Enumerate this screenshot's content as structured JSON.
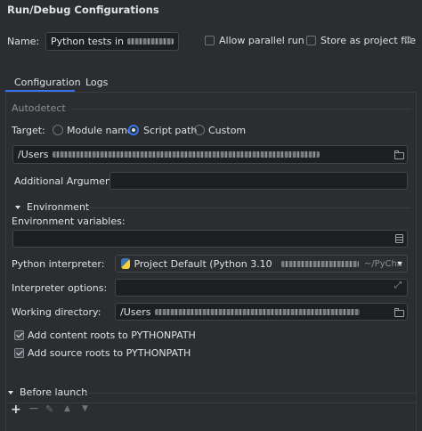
{
  "window": {
    "title": "Run/Debug Configurations"
  },
  "name_row": {
    "label": "Name:",
    "value": "Python tests in",
    "allow_parallel": "Allow parallel run",
    "store_project": "Store as project file"
  },
  "tabs": [
    {
      "label": "Configuration",
      "active": true
    },
    {
      "label": "Logs",
      "active": false
    }
  ],
  "autodetect": {
    "header": "Autodetect"
  },
  "target": {
    "label": "Target:",
    "options": [
      "Module name",
      "Script path",
      "Custom"
    ],
    "selected": "Script path"
  },
  "script_path": {
    "value": "/Users"
  },
  "additional_args": {
    "label": "Additional Arguments",
    "value": ""
  },
  "environment": {
    "header": "Environment",
    "env_vars_label": "Environment variables:",
    "env_vars_value": "",
    "interpreter_label": "Python interpreter:",
    "interpreter_value": "Project Default (Python 3.10",
    "interpreter_suffix": "~/PyCha",
    "interpreter_options_label": "Interpreter options:",
    "interpreter_options_value": "",
    "working_dir_label": "Working directory:",
    "working_dir_value": "/Users"
  },
  "checks": {
    "content_roots": "Add content roots to PYTHONPATH",
    "source_roots": "Add source roots to PYTHONPATH"
  },
  "before_launch": {
    "header": "Before launch"
  },
  "colors": {
    "accent": "#3574f0",
    "background": "#2b2d30",
    "field": "#1e1f22"
  }
}
